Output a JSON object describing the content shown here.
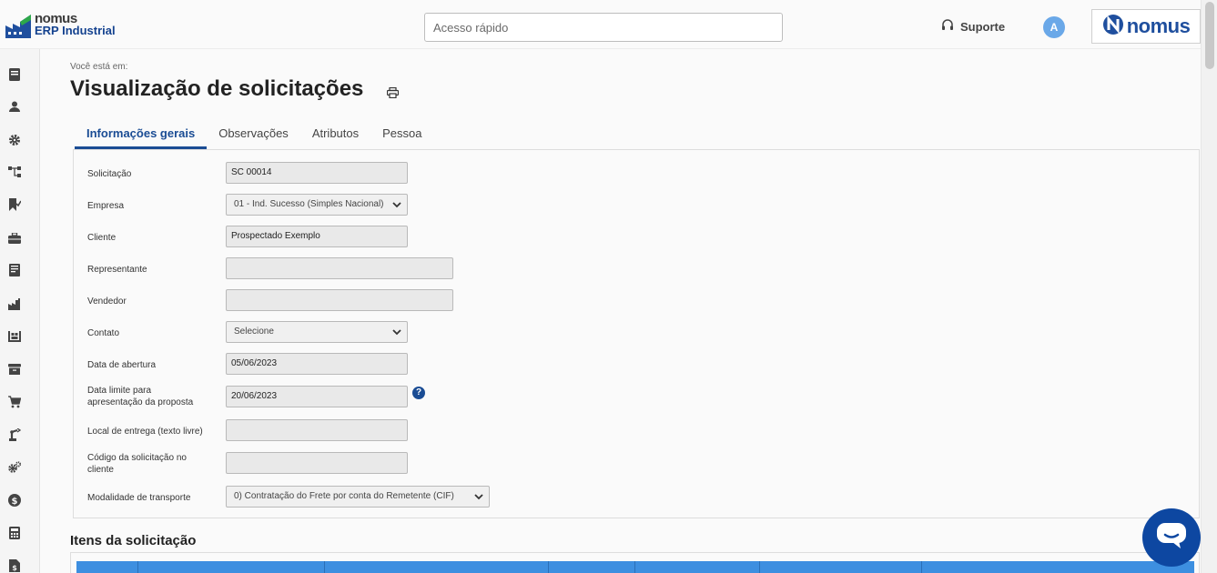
{
  "app": {
    "brand_line1": "nomus",
    "brand_line2": "ERP Industrial",
    "quick_access_placeholder": "Acesso rápido",
    "support_label": "Suporte",
    "avatar_letter": "A",
    "logo_text": "nomus"
  },
  "sidebar": {
    "icons": [
      "book-icon",
      "user-icon",
      "gear-icon",
      "hierarchy-icon",
      "bookmark-check-icon",
      "briefcase-icon",
      "ledger-icon",
      "factory-icon",
      "warehouse-icon",
      "archive-icon",
      "cart-icon",
      "robot-arm-icon",
      "cogs-icon",
      "dollar-icon",
      "calculator-icon",
      "invoice-icon"
    ]
  },
  "page": {
    "breadcrumb_label": "Você está em:",
    "title": "Visualização de solicitações"
  },
  "tabs": [
    {
      "label": "Informações gerais",
      "active": true
    },
    {
      "label": "Observações",
      "active": false
    },
    {
      "label": "Atributos",
      "active": false
    },
    {
      "label": "Pessoa",
      "active": false
    }
  ],
  "form": {
    "solicitacao": {
      "label": "Solicitação",
      "value": "SC 00014"
    },
    "empresa": {
      "label": "Empresa",
      "value": "01 - Ind. Sucesso (Simples Nacional)"
    },
    "cliente": {
      "label": "Cliente",
      "value": "Prospectado Exemplo"
    },
    "representante": {
      "label": "Representante",
      "value": ""
    },
    "vendedor": {
      "label": "Vendedor",
      "value": ""
    },
    "contato": {
      "label": "Contato",
      "value": "Selecione"
    },
    "data_abertura": {
      "label": "Data de abertura",
      "value": "05/06/2023"
    },
    "data_limite": {
      "label_l1": "Data limite para",
      "label_l2": "apresentação da proposta",
      "value": "20/06/2023",
      "help": "?"
    },
    "local_entrega": {
      "label": "Local de entrega (texto livre)",
      "value": ""
    },
    "codigo_cliente": {
      "label_l1": "Código da solicitação no",
      "label_l2": "cliente",
      "value": ""
    },
    "modalidade": {
      "label": "Modalidade de transporte",
      "value": "0) Contratação do Frete por conta do Remetente (CIF)"
    }
  },
  "items": {
    "title": "Itens da solicitação"
  },
  "colors": {
    "primary": "#1a4c94",
    "table_header": "#3d8fe0",
    "chat_button": "#0d47a1"
  }
}
